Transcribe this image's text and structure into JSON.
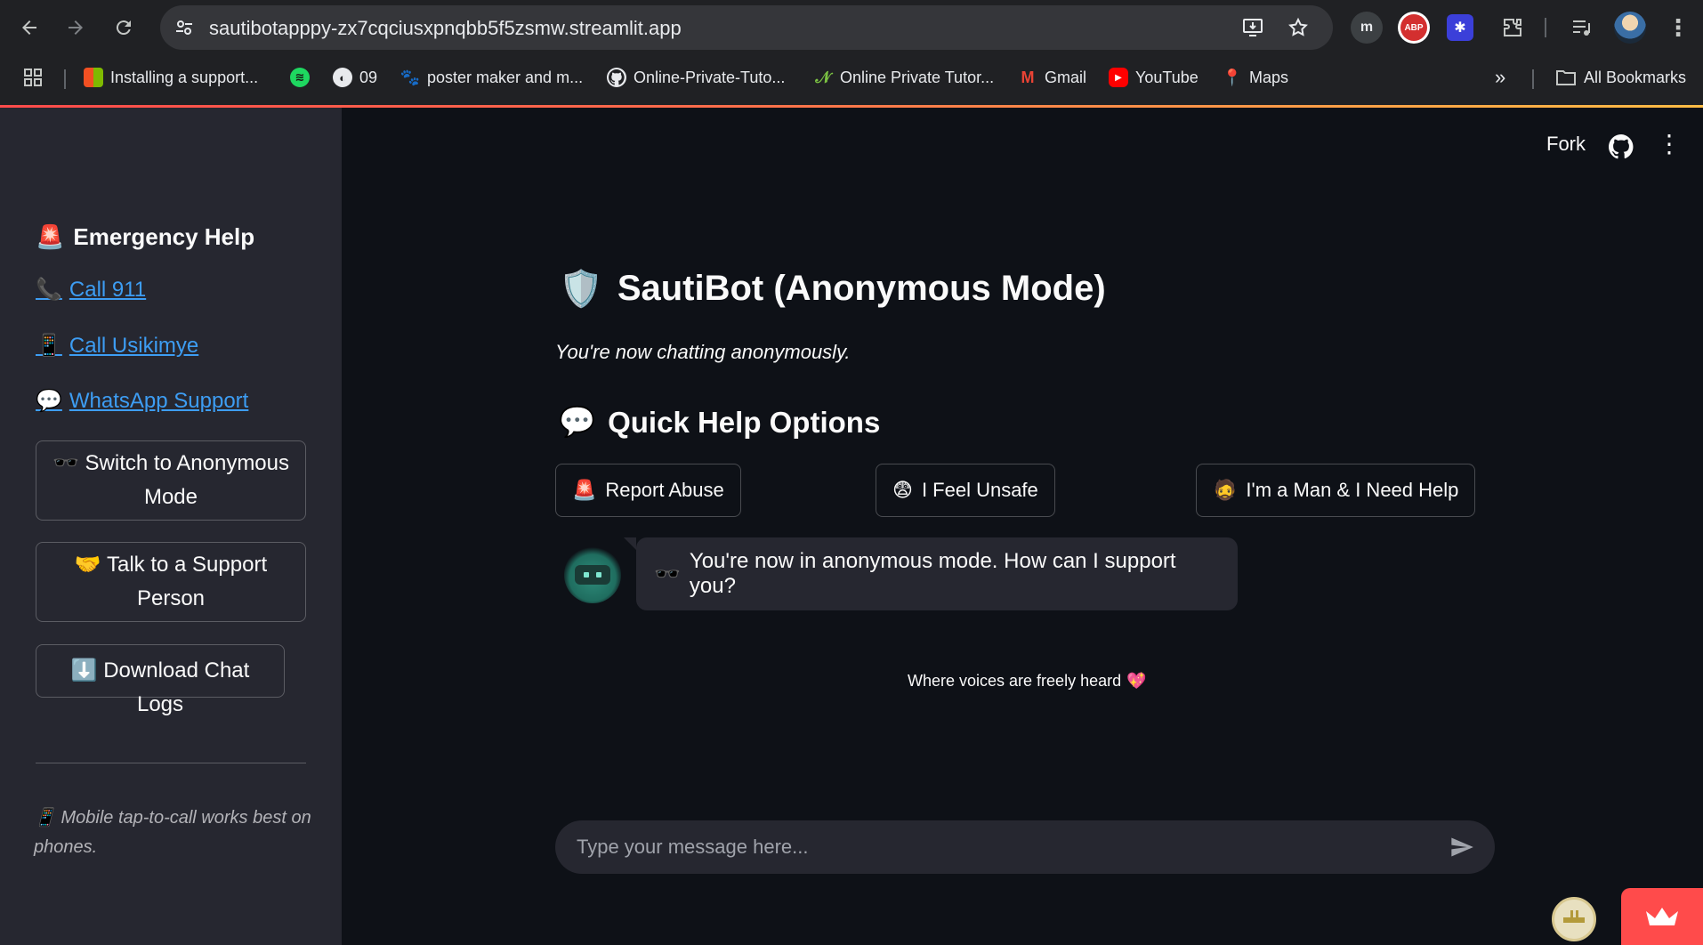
{
  "browser": {
    "url": "sautibotapppy-zx7cqciusxpnqbb5f5zsmw.streamlit.app",
    "extensions": [
      "m",
      "ABP"
    ],
    "bookmarks": [
      {
        "label": "Installing a support...",
        "icon": "windows-icon"
      },
      {
        "label": "",
        "icon": "spotify-icon"
      },
      {
        "label": "09",
        "icon": "globe-icon"
      },
      {
        "label": "poster maker and m...",
        "icon": "paw-icon"
      },
      {
        "label": "Online-Private-Tuto...",
        "icon": "github-icon"
      },
      {
        "label": "Online Private Tutor...",
        "icon": "leaf-icon"
      },
      {
        "label": "Gmail",
        "icon": "gmail-icon"
      },
      {
        "label": "YouTube",
        "icon": "youtube-icon"
      },
      {
        "label": "Maps",
        "icon": "maps-icon"
      }
    ],
    "all_bookmarks": "All Bookmarks"
  },
  "header": {
    "fork": "Fork"
  },
  "sidebar": {
    "heading": "Emergency Help",
    "heading_emoji": "🚨",
    "links": [
      {
        "emoji": "📞",
        "label": "Call 911"
      },
      {
        "emoji": "📱",
        "label": "Call Usikimye"
      },
      {
        "emoji": "💬",
        "label": "WhatsApp Support"
      }
    ],
    "buttons": [
      {
        "emoji": "🕶️",
        "label": "Switch to Anonymous Mode"
      },
      {
        "emoji": "🤝",
        "label": "Talk to a Support Person"
      },
      {
        "emoji": "⬇️",
        "label": "Download Chat Logs"
      }
    ],
    "note_emoji": "📱",
    "note": "Mobile tap-to-call works best on phones."
  },
  "main": {
    "title_emoji": "🛡️",
    "title": "SautiBot (Anonymous Mode)",
    "subtitle": "You're now chatting anonymously.",
    "quick_help_emoji": "💬",
    "quick_help_title": "Quick Help Options",
    "quick_buttons": [
      {
        "emoji": "🚨",
        "label": "Report Abuse"
      },
      {
        "emoji": "😨",
        "label": "I Feel Unsafe"
      },
      {
        "emoji": "🧔",
        "label": "I'm a Man & I Need Help"
      }
    ],
    "bot_message_emoji": "🕶️",
    "bot_message": "You're now in anonymous mode. How can I support you?",
    "footer": "Where voices are freely heard",
    "footer_emoji": "💖",
    "input_placeholder": "Type your message here..."
  },
  "colors": {
    "accent": "#ff4b4b",
    "link": "#3d9df3",
    "app_bg": "#0e1117",
    "sidebar_bg": "#262730"
  }
}
